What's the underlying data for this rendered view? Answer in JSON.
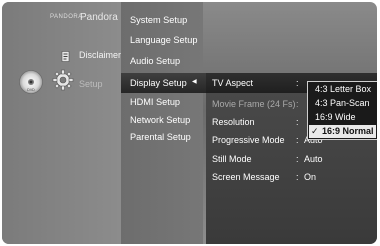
{
  "left": {
    "pandora_logo_text": "PANDORA",
    "pandora_label": "Pandora",
    "disclaimer_label": "Disclaimer",
    "setup_label": "Setup",
    "icons": [
      "disclaimer-icon",
      "dvd-disc-icon",
      "gear-icon"
    ]
  },
  "setup_menu": {
    "items": [
      "System Setup",
      "Language Setup",
      "Audio Setup",
      "Display Setup",
      "HDMI Setup",
      "Network Setup",
      "Parental Setup"
    ],
    "selected": "Display Setup"
  },
  "display_setup": {
    "rows": [
      {
        "label": "TV Aspect",
        "value": ""
      },
      {
        "label": "Movie Frame (24 Fs)",
        "value": ""
      },
      {
        "label": "Resolution",
        "value": ""
      },
      {
        "label": "Progressive Mode",
        "value": "Auto"
      },
      {
        "label": "Still Mode",
        "value": "Auto"
      },
      {
        "label": "Screen Message",
        "value": "On"
      }
    ],
    "separator": ":"
  },
  "tv_aspect_dropdown": {
    "options": [
      "4:3 Letter Box",
      "4:3 Pan-Scan",
      "16:9 Wide",
      "16:9 Normal"
    ],
    "selected": "16:9 Normal",
    "check": "✓"
  },
  "colors": {
    "background": "#7a7a7a",
    "highlight": "#2a2a2a",
    "dropdown_bg": "#1a1a1a",
    "selected_option_bg": "#e9e9e9"
  }
}
